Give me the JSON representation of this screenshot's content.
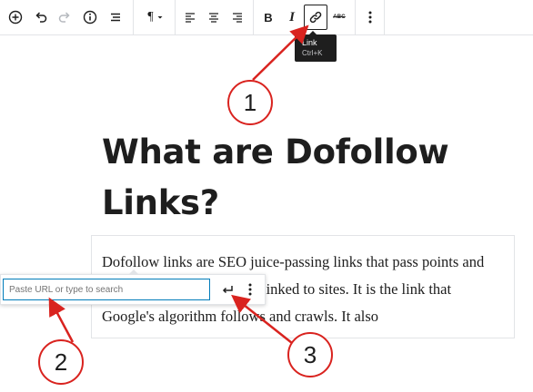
{
  "toolbar": {
    "buttons": [
      {
        "name": "add-block-icon"
      },
      {
        "name": "undo-icon"
      },
      {
        "name": "redo-icon"
      },
      {
        "name": "info-icon"
      },
      {
        "name": "list-view-icon"
      },
      {
        "name": "paragraph-icon"
      },
      {
        "name": "align-left-icon"
      },
      {
        "name": "align-center-icon"
      },
      {
        "name": "align-right-icon"
      },
      {
        "name": "bold-icon"
      },
      {
        "name": "italic-icon"
      },
      {
        "name": "link-icon"
      },
      {
        "name": "strikethrough-icon"
      },
      {
        "name": "more-options-icon"
      }
    ],
    "paragraph_glyph": "¶",
    "bold_glyph": "B",
    "italic_glyph": "I",
    "strike_glyph": "ABC"
  },
  "tooltip": {
    "label": "Link",
    "shortcut": "Ctrl+K"
  },
  "content": {
    "heading": "What are Dofollow Links?",
    "paragraph_line1": "Dofollow links are SEO juice-passing links that pass points and",
    "paragraph_line2": "linked to sites. It is the link that",
    "paragraph_line3": "Google's algorithm follows and crawls. It also"
  },
  "link_popover": {
    "placeholder": "Paste URL or type to search",
    "value": ""
  },
  "annotations": [
    "1",
    "2",
    "3"
  ],
  "colors": {
    "annotation": "#d9231f",
    "focus": "#007cba",
    "text": "#1e1e1e"
  }
}
